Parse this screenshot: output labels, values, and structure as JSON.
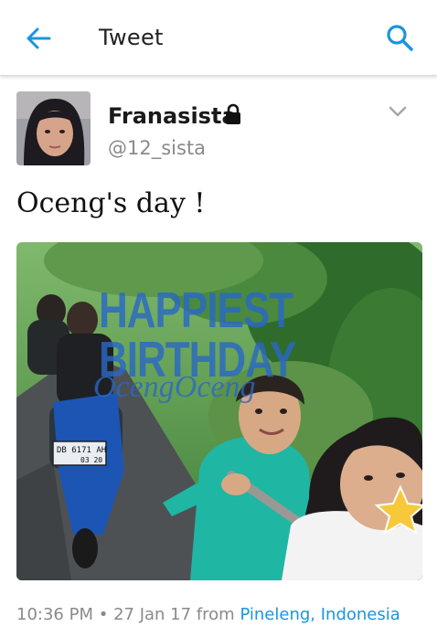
{
  "header": {
    "title": "Tweet",
    "back_icon": "arrow-left-icon",
    "search_icon": "search-icon",
    "accent": "#1c94e0"
  },
  "tweet": {
    "display_name": "Franasista",
    "handle": "@12_sista",
    "protected_icon": "lock-icon",
    "menu_icon": "chevron-down-icon",
    "text": "Oceng's day !",
    "media": {
      "overlay_line1": "HAPPIEST",
      "overlay_line2": "BIRTHDAY",
      "overlay_line3": "OcengOceng",
      "plate_line1": "DB 6171 AH",
      "plate_line2": "03 20"
    },
    "time": "10:36 PM",
    "separator": "•",
    "date": "27 Jan 17",
    "from_label": "from",
    "location": "Pineleng, Indonesia"
  }
}
